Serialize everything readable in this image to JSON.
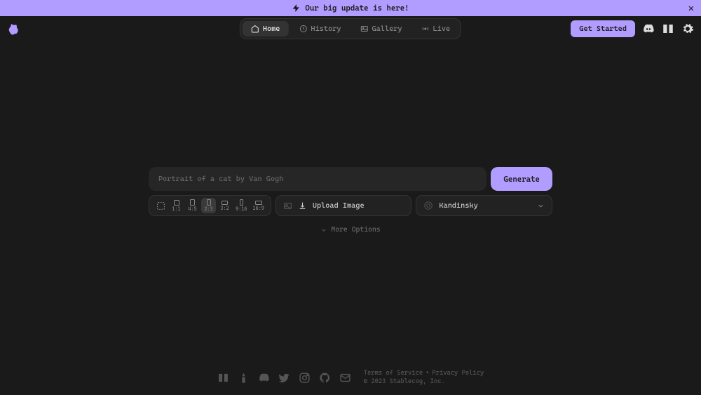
{
  "banner": {
    "text": "Our big update is here!"
  },
  "nav": {
    "home": "Home",
    "history": "History",
    "gallery": "Gallery",
    "live": "Live"
  },
  "cta": {
    "get_started": "Get Started"
  },
  "prompt": {
    "placeholder": "Portrait of a cat by Van Gogh",
    "generate": "Generate"
  },
  "ratios": [
    "1:1",
    "4:5",
    "2:3",
    "3:2",
    "9:16",
    "16:9"
  ],
  "selected_ratio_index": 2,
  "upload": {
    "label": "Upload Image"
  },
  "model": {
    "selected": "Kandinsky"
  },
  "more_options": "More Options",
  "footer": {
    "tos": "Terms of Service",
    "pp": "Privacy Policy",
    "copyright": "© 2023 Stablecog, Inc."
  },
  "colors": {
    "accent": "#b19cff",
    "bg": "#1a1a1a"
  }
}
